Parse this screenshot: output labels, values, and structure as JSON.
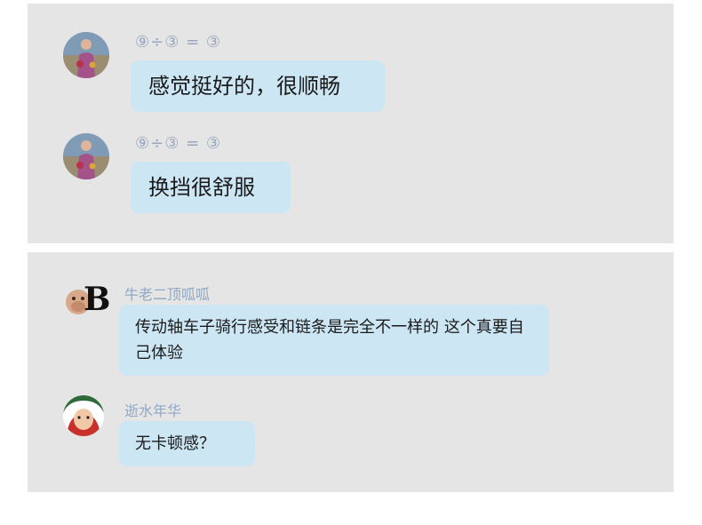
{
  "panel1": {
    "messages": [
      {
        "sender": "⑨÷③ = ③",
        "text": "感觉挺好的，很顺畅"
      },
      {
        "sender": "⑨÷③ = ③",
        "text": "换挡很舒服"
      }
    ]
  },
  "panel2": {
    "messages": [
      {
        "sender": "牛老二顶呱呱",
        "text": "传动轴车子骑行感受和链条是完全不一样的 这个真要自己体验",
        "avatar_letter": "B"
      },
      {
        "sender": "逝水年华",
        "text": "无卡顿感？"
      }
    ]
  }
}
